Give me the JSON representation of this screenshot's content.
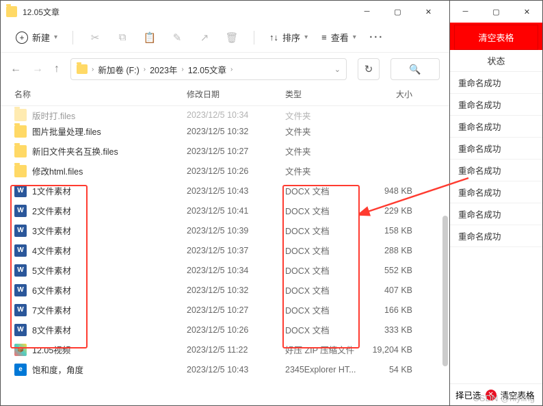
{
  "window": {
    "title": "12.05文章"
  },
  "toolbar": {
    "new_label": "新建",
    "sort_label": "排序",
    "view_label": "查看"
  },
  "breadcrumb": {
    "items": [
      "新加卷 (F:)",
      "2023年",
      "12.05文章"
    ]
  },
  "columns": {
    "name": "名称",
    "date": "修改日期",
    "type": "类型",
    "size": "大小"
  },
  "files": [
    {
      "icon": "folder",
      "name": "图片批量处理.files",
      "date": "2023/12/5 10:32",
      "type": "文件夹",
      "size": ""
    },
    {
      "icon": "folder",
      "name": "新旧文件夹名互换.files",
      "date": "2023/12/5 10:27",
      "type": "文件夹",
      "size": ""
    },
    {
      "icon": "folder",
      "name": "修改html.files",
      "date": "2023/12/5 10:26",
      "type": "文件夹",
      "size": ""
    },
    {
      "icon": "docx",
      "name": "1文件素材",
      "date": "2023/12/5 10:43",
      "type": "DOCX 文档",
      "size": "948 KB"
    },
    {
      "icon": "docx",
      "name": "2文件素材",
      "date": "2023/12/5 10:41",
      "type": "DOCX 文档",
      "size": "229 KB"
    },
    {
      "icon": "docx",
      "name": "3文件素材",
      "date": "2023/12/5 10:39",
      "type": "DOCX 文档",
      "size": "158 KB"
    },
    {
      "icon": "docx",
      "name": "4文件素材",
      "date": "2023/12/5 10:37",
      "type": "DOCX 文档",
      "size": "288 KB"
    },
    {
      "icon": "docx",
      "name": "5文件素材",
      "date": "2023/12/5 10:34",
      "type": "DOCX 文档",
      "size": "552 KB"
    },
    {
      "icon": "docx",
      "name": "6文件素材",
      "date": "2023/12/5 10:32",
      "type": "DOCX 文档",
      "size": "407 KB"
    },
    {
      "icon": "docx",
      "name": "7文件素材",
      "date": "2023/12/5 10:27",
      "type": "DOCX 文档",
      "size": "166 KB"
    },
    {
      "icon": "docx",
      "name": "8文件素材",
      "date": "2023/12/5 10:26",
      "type": "DOCX 文档",
      "size": "333 KB"
    },
    {
      "icon": "zip",
      "name": "12.05视频",
      "date": "2023/12/5 11:22",
      "type": "好压 ZIP 压缩文件",
      "size": "19,204 KB"
    },
    {
      "icon": "html",
      "name": "饱和度，角度",
      "date": "2023/12/5 10:43",
      "type": "2345Explorer HT...",
      "size": "54 KB"
    }
  ],
  "truncated_row": {
    "name": "版时打.files",
    "date": "2023/12/5 10:34",
    "type": "文件夹",
    "size": ""
  },
  "right": {
    "clear_button": "清空表格",
    "status_header": "状态",
    "statuses": [
      "重命名成功",
      "重命名成功",
      "重命名成功",
      "重命名成功",
      "重命名成功",
      "重命名成功",
      "重命名成功",
      "重命名成功"
    ],
    "footer_selected": "择已选",
    "footer_clear": "清空表格"
  },
  "watermark": "CSDN @hlyling"
}
